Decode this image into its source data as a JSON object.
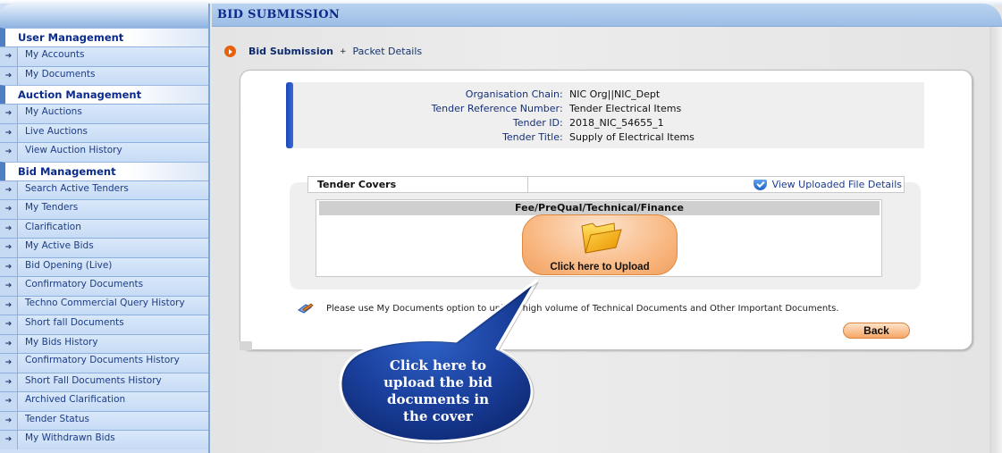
{
  "sidebar": {
    "sections": [
      {
        "title": "User Management",
        "items": [
          "My Accounts",
          "My Documents"
        ]
      },
      {
        "title": "Auction Management",
        "items": [
          "My Auctions",
          "Live Auctions",
          "View Auction History"
        ]
      },
      {
        "title": "Bid Management",
        "items": [
          "Search Active Tenders",
          "My Tenders",
          "Clarification",
          "My Active Bids",
          "Bid Opening (Live)",
          "Confirmatory Documents",
          "Techno Commercial Query History",
          "Short fall Documents",
          "My Bids History",
          "Confirmatory Documents History",
          "Short Fall Documents History",
          "Archived Clarification",
          "Tender Status",
          "My Withdrawn Bids"
        ]
      }
    ]
  },
  "header": {
    "title": "BID SUBMISSION"
  },
  "breadcrumb": {
    "current_section": "Bid Submission",
    "separator": "+",
    "page": "Packet Details"
  },
  "tender_info": [
    {
      "label": "Organisation Chain",
      "value": "NIC Org||NIC_Dept"
    },
    {
      "label": "Tender Reference Number",
      "value": "Tender Electrical Items"
    },
    {
      "label": "Tender ID",
      "value": "2018_NIC_54655_1"
    },
    {
      "label": "Tender Title",
      "value": "Supply of Electrical Items"
    }
  ],
  "covers": {
    "heading": "Tender Covers",
    "view_link": "View Uploaded File Details",
    "cover_name": "Fee/PreQual/Technical/Finance",
    "upload_label": "Click here to Upload"
  },
  "note": "Please use My Documents option to upload high volume of Technical Documents and Other Important Documents.",
  "back_label": "Back",
  "callout": {
    "lines": [
      "Click here to",
      "upload the bid",
      "documents in",
      "the cover"
    ]
  },
  "colors": {
    "accent_orange": "#e8620c",
    "header_blue": "#0d2a8a",
    "callout_blue": "#1a3f9c"
  }
}
